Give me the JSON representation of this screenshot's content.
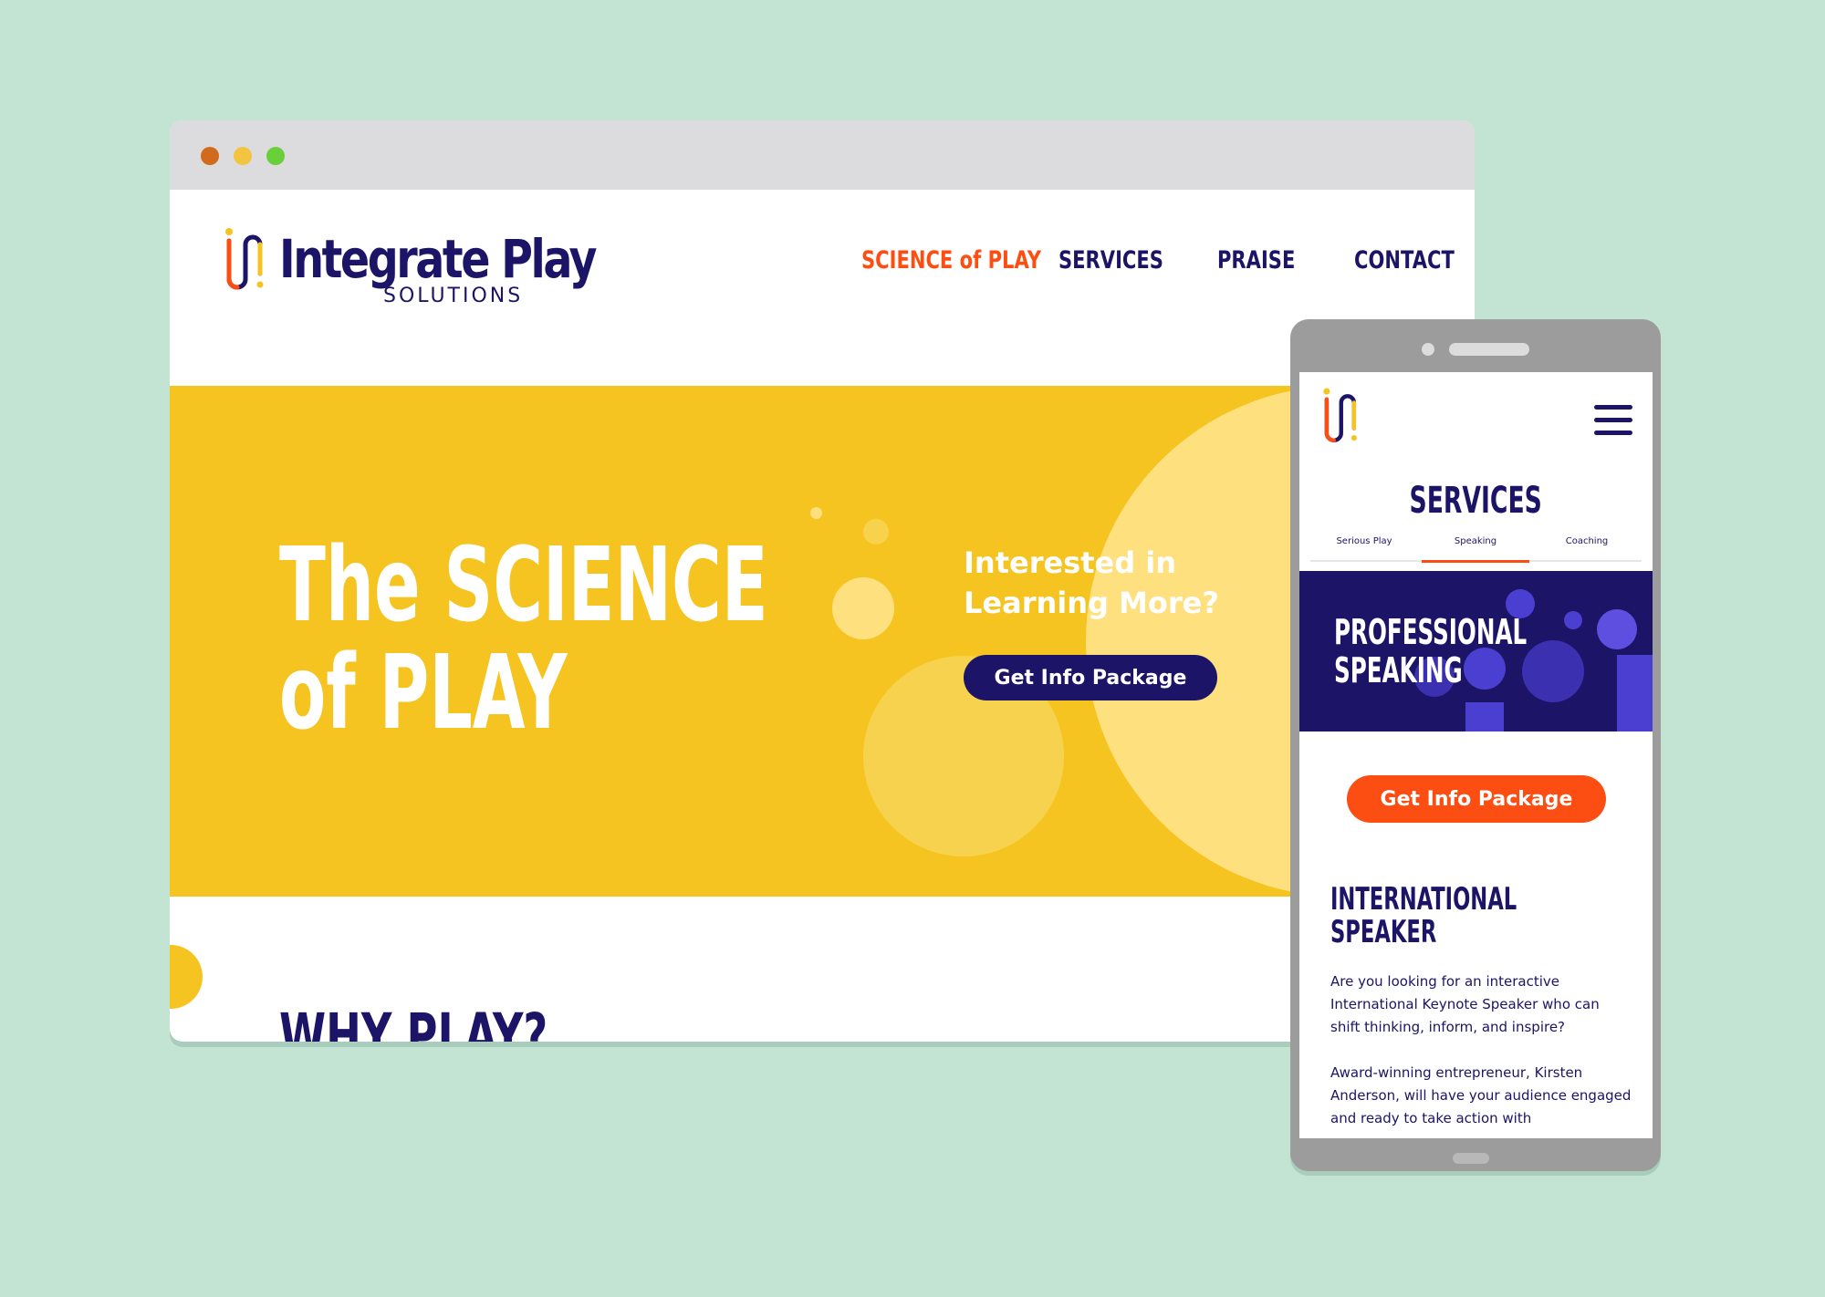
{
  "colors": {
    "background": "#c4e4d3",
    "navy": "#1c1466",
    "orange": "#fc4e12",
    "yellow": "#f5c420",
    "light_yellow": "#ffe07f",
    "purple": "#4a3fd0"
  },
  "desktop": {
    "window_dots": [
      "close-dot",
      "minimize-dot",
      "maximize-dot"
    ],
    "logo": {
      "name": "Integrate Play",
      "sub": "SOLUTIONS"
    },
    "nav": [
      {
        "label": "SCIENCE of PLAY",
        "active": true
      },
      {
        "label": "SERVICES",
        "active": false
      },
      {
        "label": "PRAISE",
        "active": false
      },
      {
        "label": "CONTACT",
        "active": false
      }
    ],
    "hero": {
      "title_line1": "The SCIENCE",
      "title_line2": "of PLAY",
      "cta_text": "Interested in Learning More?",
      "button": "Get Info Package"
    },
    "section_title": "WHY PLAY?"
  },
  "mobile": {
    "menu_icon": "hamburger-icon",
    "page_title": "SERVICES",
    "tabs": [
      {
        "label": "Serious Play",
        "active": false
      },
      {
        "label": "Speaking",
        "active": true
      },
      {
        "label": "Coaching",
        "active": false
      }
    ],
    "banner": {
      "line1": "PROFESSIONAL",
      "line2": "SPEAKING"
    },
    "button": "Get Info Package",
    "heading_line1": "INTERNATIONAL",
    "heading_line2": "SPEAKER",
    "paragraph1": "Are you looking for an interactive International Keynote Speaker who can shift thinking, inform, and inspire?",
    "paragraph2": "Award-winning entrepreneur, Kirsten Anderson, will have your audience engaged and ready to take action with"
  }
}
